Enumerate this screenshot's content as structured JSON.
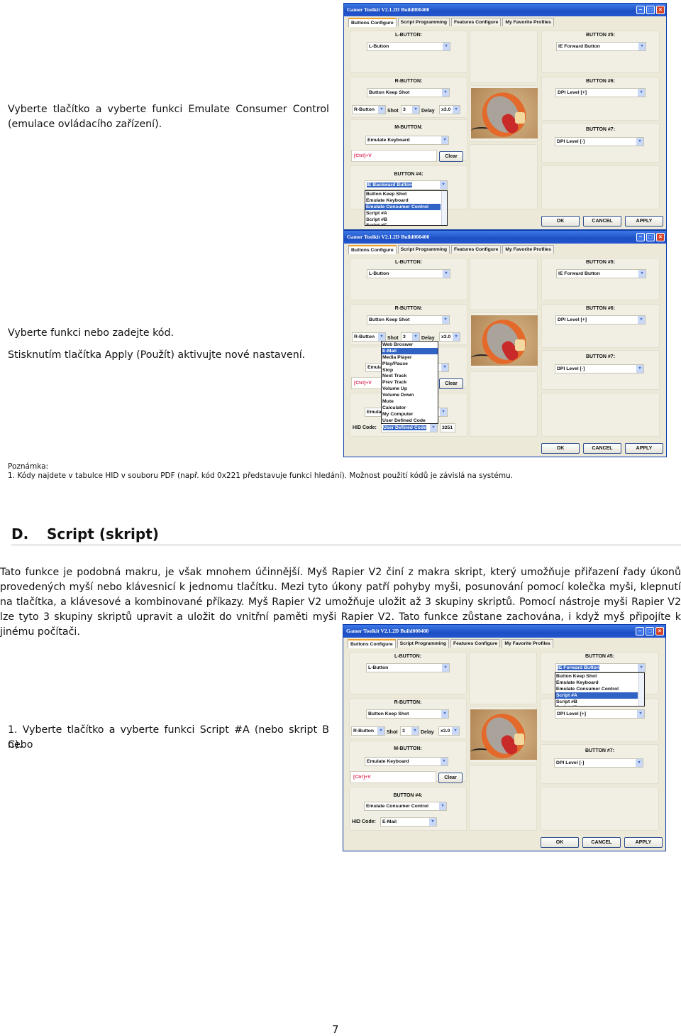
{
  "text": {
    "step_emulate_1": "Vyberte tlačítko a vyberte funkci Emulate Consumer Control",
    "step_emulate_2": "(emulace ovládacího zařízení).",
    "step_code": "Vyberte funkci nebo zadejte kód.",
    "step_apply": "Stisknutím tlačítka Apply (Použít) aktivujte nové nastavení.",
    "note_title": "Poznámka:",
    "note_1": "1.  Kódy najdete v tabulce HID v souboru PDF (např. kód 0x221 představuje funkci hledání). Možnost použití kódů je závislá na systému.",
    "section_letter": "D.",
    "section_title": "Script (skript)",
    "section_paragraph": "Tato funkce je podobná makru, je však mnohem účinnější. Myš Rapier V2 činí z makra skript, který umožňuje přiřazení řady úkonů provedených myší nebo klávesnicí k jednomu tlačítku. Mezi tyto úkony patří pohyby myši, posunování pomocí kolečka myši, klepnutí na tlačítka, a klávesové a kombinované příkazy. Myš Rapier V2 umožňuje uložit až 3 skupiny skriptů. Pomocí nástroje myši Rapier V2 lze tyto 3 skupiny skriptů upravit a uložit do vnitřní paměti myši Rapier V2. Tato funkce zůstane zachována, i když myš připojíte k jinému počítači.",
    "script_step_1a": "1.   Vyberte tlačítko a vyberte funkci Script #A (nebo skript B nebo",
    "script_step_1b": "C).",
    "page_number": "7"
  },
  "gui": {
    "title": "Gamer Toolkit V2.1.2D Build000400",
    "tabs": [
      "Buttons Configure",
      "Script Programming",
      "Features Configure",
      "My Favorite Profiles"
    ],
    "labels": {
      "l": "L-BUTTON:",
      "r": "R-BUTTON:",
      "m": "M-BUTTON:",
      "b4": "BUTTON #4:",
      "b5": "BUTTON #5:",
      "b6": "BUTTON #6:",
      "b7": "BUTTON #7:"
    },
    "shot_label": "Shot",
    "delay_label": "Delay",
    "hid_label": "HID Code:",
    "clear": "Clear",
    "ok": "OK",
    "cancel": "CANCEL",
    "apply": "APPLY",
    "colors": {
      "titlebar": "#1d4fc4",
      "highlight": "#3163c5",
      "keys_text": "#d8305a"
    }
  },
  "windows": [
    {
      "l_sel": "L-Button",
      "r_sel": "Button Keep Shot",
      "r_mode": "R-Button",
      "shot": "3",
      "delay": "x3.0",
      "m_sel": "Emulate Keyboard",
      "keys": "[Ctrl]+V",
      "b4_sel": "IE Backward Button",
      "b4_highlight": true,
      "b5_sel": "IE Forward Button",
      "b5_highlight": false,
      "b6_sel": "DPI Level [+]",
      "b7_sel": "DPI Level [-]",
      "dropdown": {
        "anchor": "b4",
        "items": [
          "Button Keep Shot",
          "Emulate Keyboard",
          "Emulate Consumer Control",
          "Script #A",
          "Script #B",
          "Script #C"
        ],
        "selected": "Emulate Consumer Control"
      }
    },
    {
      "l_sel": "L-Button",
      "r_sel": "Button Keep Shot",
      "r_mode": "R-Button",
      "shot": "3",
      "delay": "x3.0",
      "m_sel": "Emulate Keyboard",
      "keys": "[Ctrl]+V",
      "b4_sel": "Emulate Consumer Control",
      "b4_highlight": false,
      "b5_sel": "IE Forward Button",
      "b5_highlight": false,
      "b6_sel": "DPI Level [+]",
      "b7_sel": "DPI Level [-]",
      "hid_code": "User Defined Code",
      "hid_highlight": true,
      "hid_value": "3251",
      "dropdown": {
        "anchor": "hid",
        "items": [
          "Web Broswer",
          "E-Mail",
          "Media Player",
          "Play/Pause",
          "Stop",
          "Next Track",
          "Prev Track",
          "Volume Up",
          "Volume Down",
          "Mute",
          "Calculator",
          "My Computer",
          "User Defined Code"
        ],
        "selected": "E-Mail"
      }
    },
    {
      "l_sel": "L-Button",
      "r_sel": "Button Keep Shot",
      "r_mode": "R-Button",
      "shot": "3",
      "delay": "x3.0",
      "m_sel": "Emulate Keyboard",
      "keys": "[Ctrl]+V",
      "b4_sel": "Emulate Consumer Control",
      "b4_highlight": false,
      "b5_sel": "IE Forward Button",
      "b5_highlight": true,
      "b6_sel": "DPI Level [+]",
      "b7_sel": "DPI Level [-]",
      "hid_code": "E-Mail",
      "hid_highlight": false,
      "dropdown": {
        "anchor": "b5",
        "items": [
          "Button Keep Shot",
          "Emulate Keyboard",
          "Emulate Consumer Control",
          "Script #A",
          "Script #B",
          "Script #C"
        ],
        "selected": "Script #A"
      }
    }
  ]
}
